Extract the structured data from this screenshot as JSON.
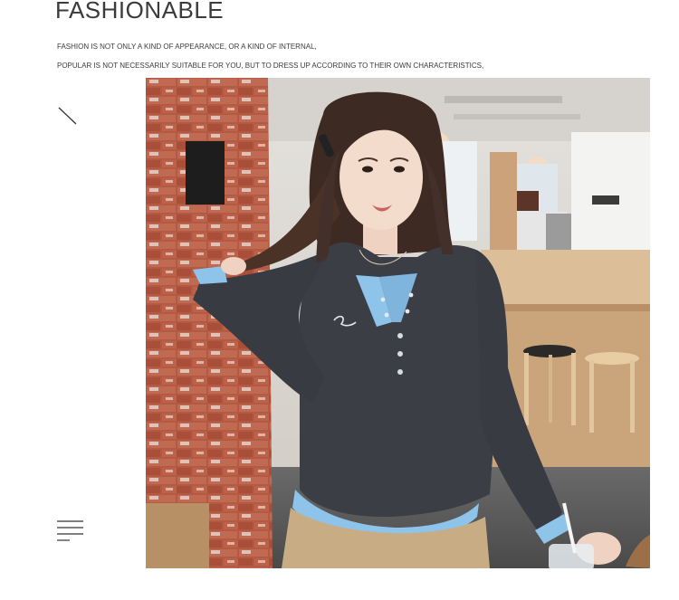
{
  "header": {
    "title": "FASHIONABLE",
    "line1": "FASHION IS NOT ONLY A KIND OF APPEARANCE, OR A KIND OF INTERNAL,",
    "line2": "POPULAR IS NOT NECESSARILY SUITABLE FOR YOU, BUT TO DRESS UP ACCORDING TO THEIR OWN CHARACTERISTICS,"
  },
  "icons": {
    "diagonal": "diagonal-line-icon",
    "menu": "menu-lines-icon"
  },
  "photo": {
    "sign_text": "",
    "colors": {
      "brick": "#b5533c",
      "shirt": "#3c3e45",
      "trim": "#8ec3ea",
      "pants": "#c8ad84",
      "counter": "#d9b98e"
    }
  }
}
